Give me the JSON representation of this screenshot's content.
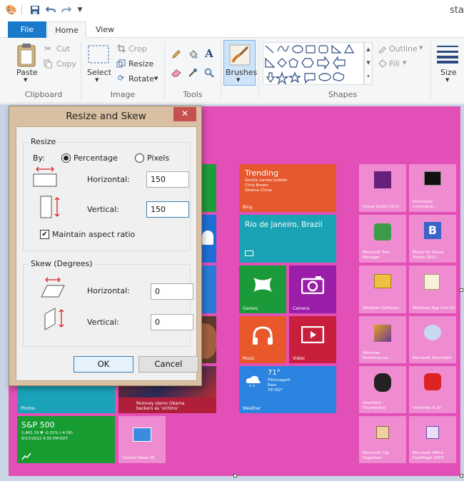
{
  "window": {
    "title_fragment": "sta"
  },
  "tabs": [
    {
      "label": "File"
    },
    {
      "label": "Home"
    },
    {
      "label": "View"
    }
  ],
  "ribbon": {
    "clipboard": {
      "paste": "Paste",
      "cut": "Cut",
      "copy": "Copy",
      "group": "Clipboard"
    },
    "image": {
      "select": "Select",
      "crop": "Crop",
      "resize": "Resize",
      "rotate": "Rotate",
      "group": "Image"
    },
    "tools": {
      "group": "Tools"
    },
    "brushes": {
      "label": "Brushes"
    },
    "shapes": {
      "outline": "Outline",
      "fill": "Fill",
      "group": "Shapes"
    },
    "size": {
      "label": "Size"
    }
  },
  "dialog": {
    "title": "Resize and Skew",
    "close": "✕",
    "resize_group": "Resize",
    "by_label": "By:",
    "percentage": "Percentage",
    "pixels": "Pixels",
    "mode": "percentage",
    "horizontal_label": "Horizontal:",
    "vertical_label": "Vertical:",
    "resize_horizontal": "150",
    "resize_vertical": "150",
    "maintain_aspect": "Maintain aspect ratio",
    "maintain_checked": true,
    "skew_group": "Skew (Degrees)",
    "skew_horizontal_label": "Horizontal:",
    "skew_vertical_label": "Vertical:",
    "skew_horizontal": "0",
    "skew_vertical": "0",
    "ok": "OK",
    "cancel": "Cancel"
  },
  "tiles": {
    "trending_title": "Trending",
    "trending_lines": [
      "Gorilla carries toddler",
      "Chris Brown",
      "Obama China"
    ],
    "trending_source": "Bing",
    "travel": "Rio de Janeiro, Brazil",
    "games": "Games",
    "camera": "Camera",
    "music": "Music",
    "video": "Video",
    "weather_temp": "71°",
    "weather_place": "Pithoragarh",
    "weather_cond": "Rain",
    "weather_range": "76°/62°",
    "weather": "Weather",
    "photos": "Photos",
    "news": "Romney slams Obama backers as 'victims'",
    "finance_title": "S&P 500",
    "finance_line1": "1,461.19  ▼ -0.31% (-4.58)",
    "finance_line2": "9/17/2012 4:35 PM EDT",
    "control_panel": "Control Panel (4)",
    "apps": [
      "Visual Studio 2012",
      "Developer Command...",
      "Microsoft Test Manager",
      "Blend for Visual Studio 2012",
      "Windows Software...",
      "Windows App Cert Kit",
      "Windows Performance...",
      "Microsoft Silverlight",
      "IrfanView - Thumbnails",
      "IrfanView 4.30",
      "Microsoft Clip Organizer",
      "Microsoft Office FrontPage 2003"
    ]
  },
  "colors": {
    "accent": "#1979ca",
    "canvas_bg": "#e24fb6",
    "dialog_frame": "#d9c0a2"
  }
}
